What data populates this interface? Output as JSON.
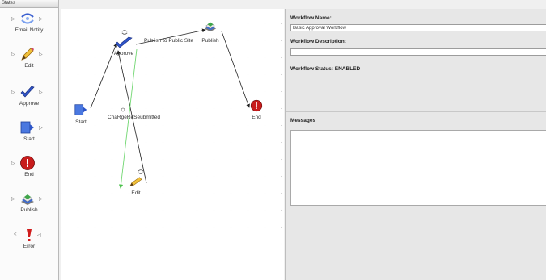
{
  "palette": {
    "header": "States",
    "items": [
      {
        "label": "Email Notify",
        "icon": "email-notify-icon"
      },
      {
        "label": "Edit",
        "icon": "pencil-icon"
      },
      {
        "label": "Approve",
        "icon": "check-icon"
      },
      {
        "label": "Start",
        "icon": "start-icon"
      },
      {
        "label": "End",
        "icon": "stop-icon"
      },
      {
        "label": "Publish",
        "icon": "publish-icon"
      },
      {
        "label": "Error",
        "icon": "error-icon"
      }
    ]
  },
  "canvas": {
    "nodes": [
      {
        "id": "start",
        "label": "Start",
        "icon": "start-icon"
      },
      {
        "id": "approve",
        "label": "Approve",
        "icon": "check-icon"
      },
      {
        "id": "publish",
        "label": "Publish",
        "icon": "publish-icon"
      },
      {
        "id": "end",
        "label": "End",
        "icon": "stop-icon"
      },
      {
        "id": "edit",
        "label": "Edit",
        "icon": "pencil-icon"
      }
    ],
    "edge_labels": {
      "publish_to_site": "Publish to Public Site",
      "overlap": "ChaRgeReSeubmitted"
    }
  },
  "properties": {
    "name_label": "Workflow Name:",
    "name_value": "Basic Approval Workflow",
    "description_label": "Workflow Description:",
    "description_value": "",
    "status_text": "Workflow Status: ENABLED",
    "messages_label": "Messages"
  },
  "colors": {
    "edge": "#222222",
    "selected_edge": "#6fd66f",
    "end_red": "#c81c1c",
    "approve_blue": "#2f54c8"
  }
}
